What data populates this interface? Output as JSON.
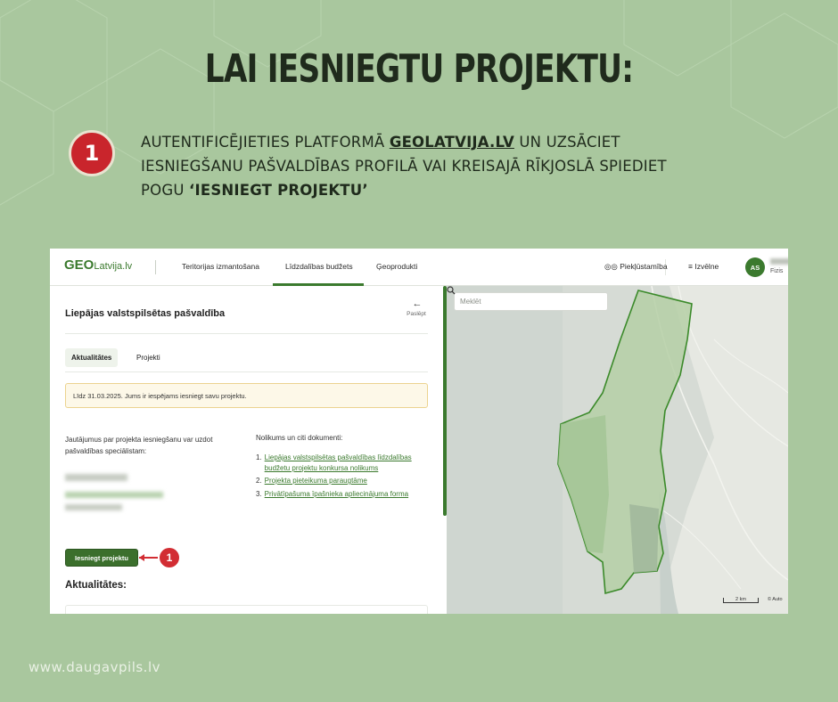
{
  "title": "LAI IESNIEGTU PROJEKTU:",
  "step": {
    "number": "1",
    "text_part1": "AUTENTIFICĒJIETIES PLATFORMĀ ",
    "link": "GEOLATVIJA.LV",
    "text_part2": " UN UZSĀCIET IESNIEGŠANU PAŠVALDĪBAS PROFILĀ VAI KREISAJĀ RĪKJOSLĀ SPIEDIET POGU ",
    "button_name": "‘IESNIEGT PROJEKTU’"
  },
  "footer": "www.daugavpils.lv",
  "screenshot": {
    "logo_geo": "GEO",
    "logo_rest": "Latvija.lv",
    "nav": [
      "Teritorijas izmantošana",
      "Līdzdalības budžets",
      "Ģeoprodukti"
    ],
    "accessibility": "Piekļūstamība",
    "menu": "Izvēlne",
    "avatar": "AS",
    "user_sub": "Fizis",
    "panel_title": "Liepājas valstspilsētas pašvaldība",
    "back_label": "Paslēpt",
    "tabs": [
      "Aktualitātes",
      "Projekti"
    ],
    "notice": "Līdz 31.03.2025. Jums ir iespējams iesniegt savu projektu.",
    "contact_text": "Jautājumus par projekta iesniegšanu var uzdot pašvaldības speciālistam:",
    "docs_title": "Nolikums un citi dokumenti:",
    "docs": [
      {
        "num": "1.",
        "label": "Liepājas valstspilsētas pašvaldības līdzdalības budžetu projektu konkursa nolikums"
      },
      {
        "num": "2.",
        "label": "Projekta pieteikuma paraugtāme"
      },
      {
        "num": "3.",
        "label": "Privātīpašuma īpašnieka apliecinājuma forma"
      }
    ],
    "submit_button": "Iesniegt projektu",
    "callout_number": "1",
    "news_heading": "Aktualitātes:",
    "search_placeholder": "Meklēt",
    "scale": "2 km",
    "attribution": "© Auto"
  },
  "colors": {
    "background": "#a9c79e",
    "accent_green": "#3b7a2e",
    "badge_red": "#c9252c",
    "title_text": "#1f2a1c"
  }
}
